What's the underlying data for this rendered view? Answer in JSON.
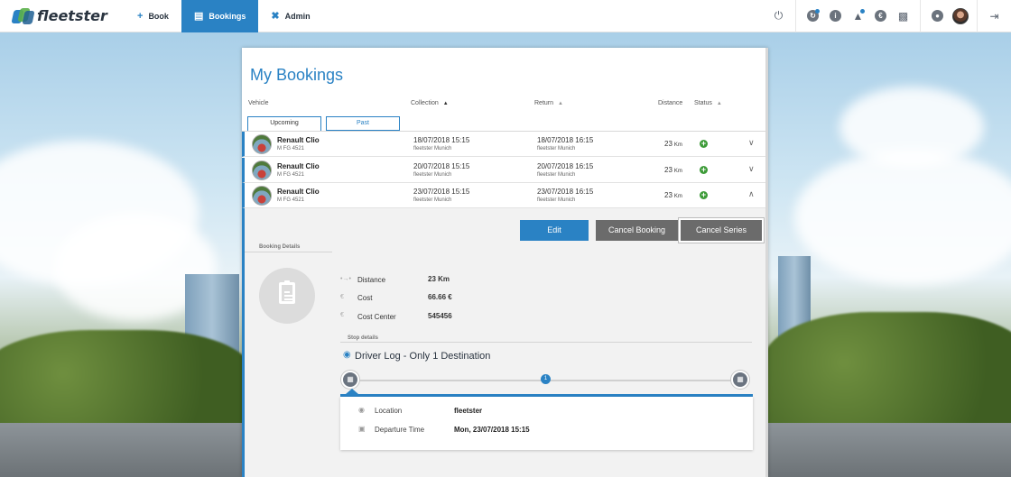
{
  "app": {
    "brand": "fleetster"
  },
  "nav": {
    "items": [
      {
        "label": "Book",
        "icon": "plus-icon"
      },
      {
        "label": "Bookings",
        "icon": "document-icon",
        "active": true
      },
      {
        "label": "Admin",
        "icon": "tools-icon"
      }
    ],
    "right_icons": [
      "power-icon",
      "update-icon",
      "info-icon",
      "bell-icon",
      "euro-icon",
      "vehicles-icon",
      "globe-icon",
      "user-avatar",
      "logout-icon"
    ]
  },
  "page": {
    "title": "My Bookings"
  },
  "table": {
    "headers": {
      "vehicle": "Vehicle",
      "collection": "Collection",
      "return": "Return",
      "distance": "Distance",
      "status": "Status"
    },
    "tabs": {
      "upcoming": "Upcoming",
      "past": "Past"
    },
    "rows": [
      {
        "vehicle": "Renault Clio",
        "plate": "M FG 4521",
        "collection": "18/07/2018 15:15",
        "collection_loc": "fleetster Munich",
        "return": "18/07/2018 16:15",
        "return_loc": "fleetster Munich",
        "distance": "23",
        "unit": "Km",
        "expanded": false
      },
      {
        "vehicle": "Renault Clio",
        "plate": "M FG 4521",
        "collection": "20/07/2018 15:15",
        "collection_loc": "fleetster Munich",
        "return": "20/07/2018 16:15",
        "return_loc": "fleetster Munich",
        "distance": "23",
        "unit": "Km",
        "expanded": false
      },
      {
        "vehicle": "Renault Clio",
        "plate": "M FG 4521",
        "collection": "23/07/2018 15:15",
        "collection_loc": "fleetster Munich",
        "return": "23/07/2018 16:15",
        "return_loc": "fleetster Munich",
        "distance": "23",
        "unit": "Km",
        "expanded": true
      }
    ]
  },
  "details": {
    "buttons": {
      "edit": "Edit",
      "cancel_booking": "Cancel Booking",
      "cancel_series": "Cancel Series"
    },
    "section_label": "Booking Details",
    "fields": [
      {
        "label": "Distance",
        "value": "23 Km"
      },
      {
        "label": "Cost",
        "value": "66.66 €"
      },
      {
        "label": "Cost Center",
        "value": "545456"
      }
    ],
    "stop_label": "Stop details",
    "stop_title": "Driver Log - Only 1 Destination",
    "stop_number": "1",
    "card": [
      {
        "label": "Location",
        "value": "fleetster"
      },
      {
        "label": "Departure Time",
        "value": "Mon, 23/07/2018 15:15"
      }
    ]
  },
  "colors": {
    "accent": "#2a82c4",
    "status_ok": "#3d9b38",
    "button_grey": "#6b6b6b"
  }
}
